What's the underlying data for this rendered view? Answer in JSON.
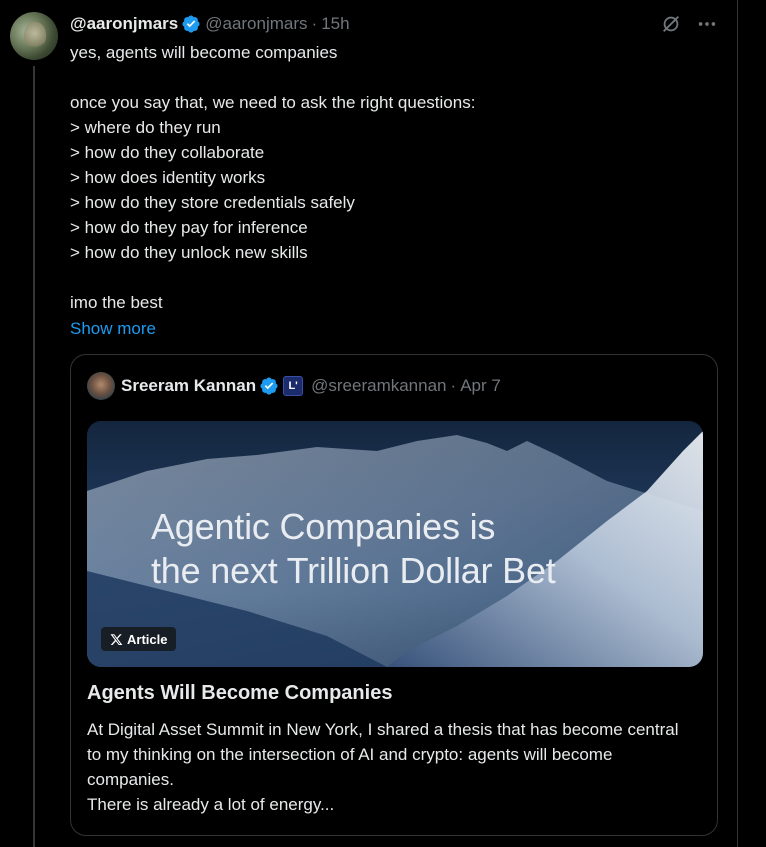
{
  "post": {
    "author": {
      "name": "@aaronjmars",
      "handle": "@aaronjmars",
      "verified": true,
      "verified_color": "#1d9bf0"
    },
    "time": "15h",
    "separator": "·",
    "icons": [
      "grok-icon",
      "more-icon"
    ],
    "text_lines": [
      "yes, agents will become companies",
      "",
      "once you say that, we need to ask the right questions:",
      "> where do they run",
      "> how do they collaborate",
      "> how does identity works",
      "> how do they store credentials safely",
      "> how do they pay for inference",
      "> how do they unlock new skills",
      "",
      "imo the best"
    ],
    "show_more_label": "Show more",
    "link_color": "#1d9bf0"
  },
  "quote": {
    "author": {
      "name": "Sreeram Kannan",
      "handle": "@sreeramkannan",
      "verified": true,
      "affiliate_badge": "L'"
    },
    "separator": "·",
    "date": "Apr 7",
    "media": {
      "title_line1": "Agentic Companies is",
      "title_line2": "the next Trillion Dollar Bet",
      "badge_label": "Article"
    },
    "article_title": "Agents Will Become Companies",
    "article_desc_line1": "At Digital Asset Summit in New York, I shared a thesis that has become central to my thinking on  the intersection of AI and crypto: agents will become companies.",
    "article_desc_line2": "There is already a lot of energy..."
  }
}
